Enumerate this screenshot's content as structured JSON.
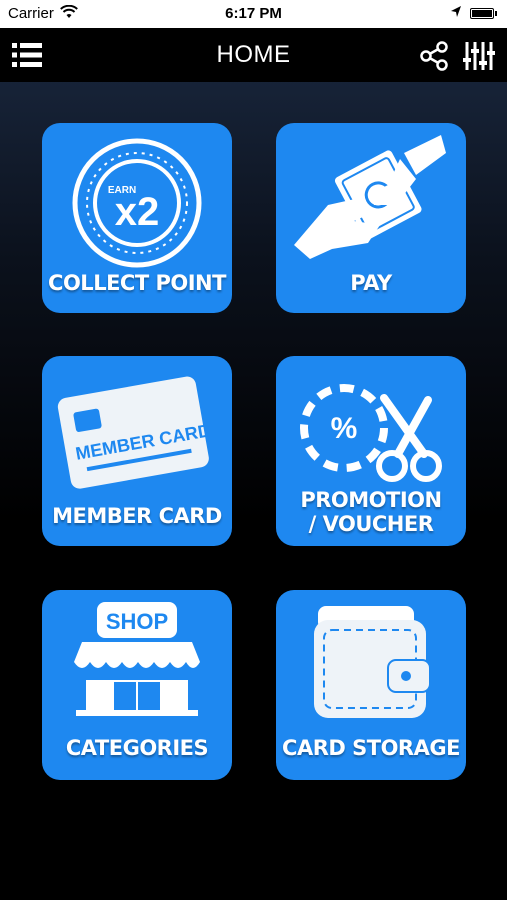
{
  "status_bar": {
    "carrier": "Carrier",
    "time": "6:17 PM",
    "icons": [
      "wifi-icon",
      "location-arrow-icon",
      "battery-icon"
    ]
  },
  "nav": {
    "title": "HOME",
    "left_icon": "menu-list-icon",
    "right_icons": [
      "share-icon",
      "equalizer-icon"
    ]
  },
  "colors": {
    "tile": "#1e88f0",
    "background_top": "#1c2b44",
    "background_bottom": "#000000"
  },
  "tiles": [
    {
      "label": "COLLECT POINT",
      "icon": "earn-x2-badge-icon",
      "badge_small": "EARN",
      "badge_big": "x2"
    },
    {
      "label": "PAY",
      "icon": "hand-pay-money-icon"
    },
    {
      "label": "MEMBER CARD",
      "icon": "member-card-icon",
      "card_text": "MEMBER CARD"
    },
    {
      "label_line1": "PROMOTION",
      "label_line2": "/ VOUCHER",
      "icon": "coupon-scissors-icon",
      "percent": "%"
    },
    {
      "label": "CATEGORIES",
      "icon": "shop-storefront-icon",
      "sign": "SHOP"
    },
    {
      "label": "CARD STORAGE",
      "icon": "wallet-icon"
    }
  ]
}
